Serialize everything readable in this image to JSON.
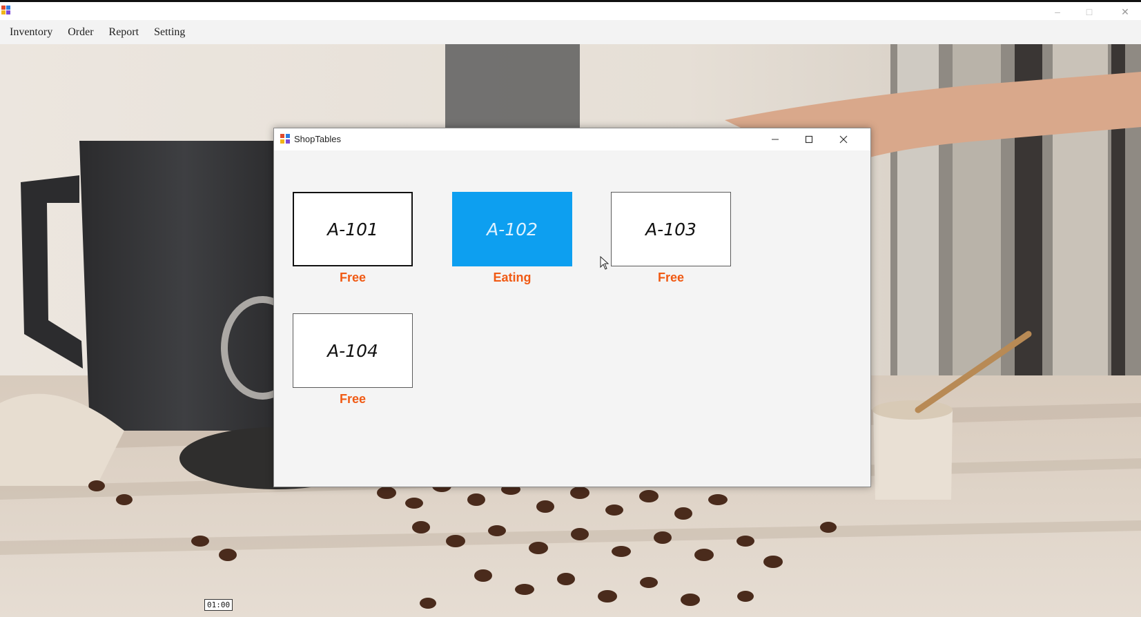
{
  "menu": {
    "items": [
      "Inventory",
      "Order",
      "Report",
      "Setting"
    ]
  },
  "app_window": {
    "controls": {
      "minimize_icon": "minimize-icon",
      "maximize_icon": "maximize-icon",
      "close_icon": "close-icon"
    }
  },
  "child_window": {
    "title": "ShopTables",
    "tables": [
      {
        "id": "A-101",
        "status": "Free",
        "state": "free"
      },
      {
        "id": "A-102",
        "status": "Eating",
        "state": "eating"
      },
      {
        "id": "A-103",
        "status": "Free",
        "state": "free"
      },
      {
        "id": "A-104",
        "status": "Free",
        "state": "free"
      }
    ]
  },
  "overlay": {
    "timestamp": "01:00"
  },
  "colors": {
    "eating_bg": "#0d9ff0",
    "status_text": "#f05a14",
    "window_bg": "#f4f4f4"
  }
}
